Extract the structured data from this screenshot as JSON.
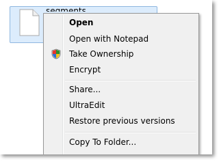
{
  "file": {
    "name": "segments"
  },
  "menu": {
    "items": [
      {
        "label": "Open",
        "bold": true
      },
      {
        "label": "Open with Notepad"
      },
      {
        "label": "Take Ownership",
        "icon": "uac-shield-icon"
      },
      {
        "label": "Encrypt"
      },
      {
        "label": "Share..."
      },
      {
        "label": "UltraEdit"
      },
      {
        "label": "Restore previous versions"
      },
      {
        "label": "Copy To Folder..."
      }
    ]
  }
}
